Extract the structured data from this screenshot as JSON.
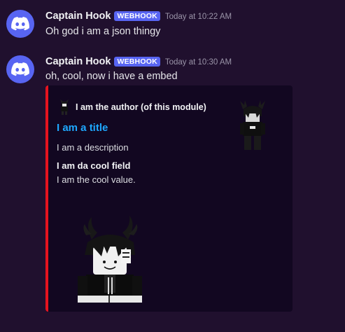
{
  "messages": [
    {
      "username": "Captain Hook",
      "badge": "WEBHOOK",
      "timestamp": "Today at 10:22 AM",
      "content": "Oh god i am a json thingy"
    },
    {
      "username": "Captain Hook",
      "badge": "WEBHOOK",
      "timestamp": "Today at 10:30 AM",
      "content": "oh, cool, now i have a embed",
      "embed": {
        "author": "I am the author (of this module)",
        "title": "I am a title",
        "description": "I am a description",
        "field": {
          "name": "I am da cool field",
          "value": "I am the cool value."
        }
      }
    }
  ],
  "icons": {
    "avatar": "discord-logo-icon"
  },
  "colors": {
    "background": "#20102e",
    "embed_background": "#120721",
    "embed_accent": "#e5131f",
    "badge": "#5865f2",
    "title_link": "#1ea8ff"
  }
}
